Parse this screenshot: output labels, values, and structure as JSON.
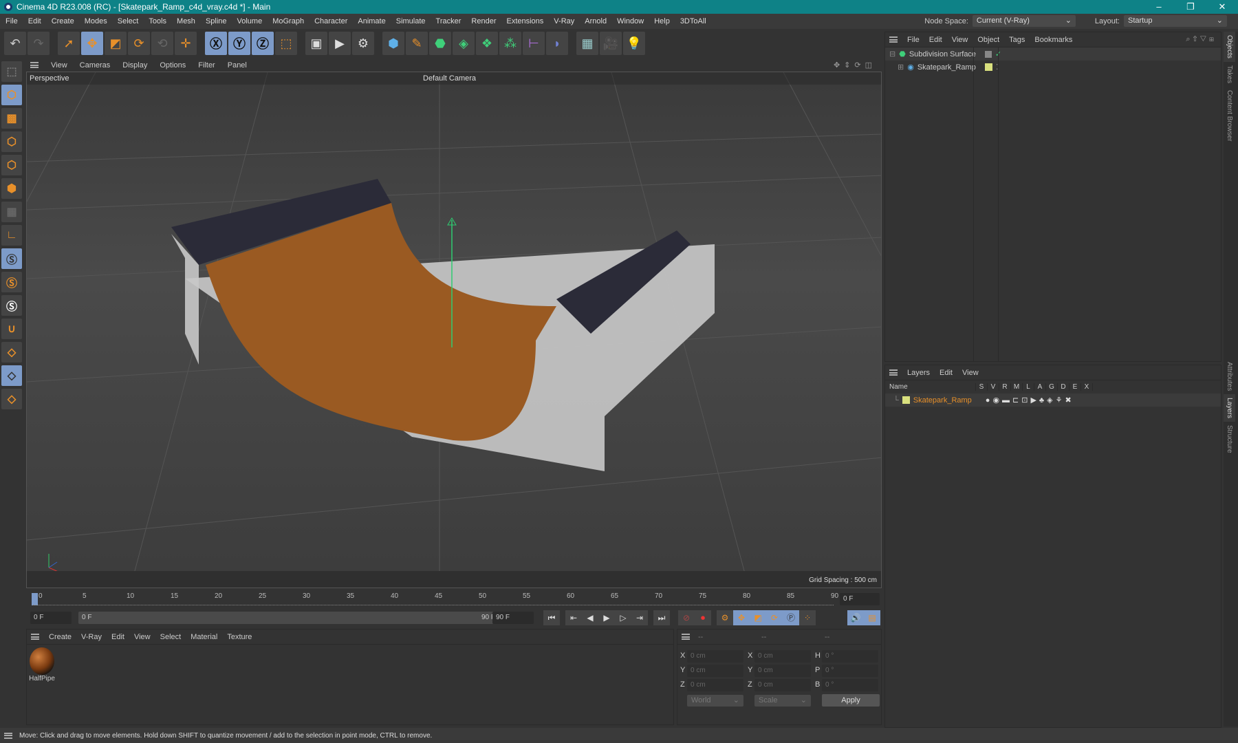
{
  "title": "Cinema 4D R23.008 (RC) - [Skatepark_Ramp_c4d_vray.c4d *] - Main",
  "menu": [
    "File",
    "Edit",
    "Create",
    "Modes",
    "Select",
    "Tools",
    "Mesh",
    "Spline",
    "Volume",
    "MoGraph",
    "Character",
    "Animate",
    "Simulate",
    "Tracker",
    "Render",
    "Extensions",
    "V-Ray",
    "Arnold",
    "Window",
    "Help",
    "3DToAll"
  ],
  "node_space": {
    "label": "Node Space:",
    "value": "Current (V-Ray)"
  },
  "layout": {
    "label": "Layout:",
    "value": "Startup"
  },
  "viewport": {
    "menu": [
      "View",
      "Cameras",
      "Display",
      "Options",
      "Filter",
      "Panel"
    ],
    "name": "Perspective",
    "camera": "Default Camera",
    "grid_spacing": "Grid Spacing : 500 cm"
  },
  "timeline": {
    "ticks": [
      "0",
      "5",
      "10",
      "15",
      "20",
      "25",
      "30",
      "35",
      "40",
      "45",
      "50",
      "55",
      "60",
      "65",
      "70",
      "75",
      "80",
      "85",
      "90"
    ],
    "current": "0 F",
    "start": "0 F",
    "range_start": "0 F",
    "range_end": "90 F",
    "end": "90 F"
  },
  "materials": {
    "menu": [
      "Create",
      "V-Ray",
      "Edit",
      "View",
      "Select",
      "Material",
      "Texture"
    ],
    "items": [
      {
        "name": "HalfPipe"
      }
    ]
  },
  "coords": {
    "headers": [
      "--",
      "--",
      "--"
    ],
    "rows": [
      {
        "a": "X",
        "av": "0 cm",
        "b": "X",
        "bv": "0 cm",
        "c": "H",
        "cv": "0 °"
      },
      {
        "a": "Y",
        "av": "0 cm",
        "b": "Y",
        "bv": "0 cm",
        "c": "P",
        "cv": "0 °"
      },
      {
        "a": "Z",
        "av": "0 cm",
        "b": "Z",
        "bv": "0 cm",
        "c": "B",
        "cv": "0 °"
      }
    ],
    "space": "World",
    "mode": "Scale",
    "apply": "Apply"
  },
  "status": "Move: Click and drag to move elements. Hold down SHIFT to quantize movement / add to the selection in point mode, CTRL to remove.",
  "objects": {
    "menu": [
      "File",
      "Edit",
      "View",
      "Object",
      "Tags",
      "Bookmarks"
    ],
    "items": [
      "Subdivision Surface",
      "Skatepark_Ramp"
    ]
  },
  "layers": {
    "menu": [
      "Layers",
      "Edit",
      "View"
    ],
    "columns": [
      "Name",
      "S",
      "V",
      "R",
      "M",
      "L",
      "A",
      "G",
      "D",
      "E",
      "X"
    ],
    "items": [
      "Skatepark_Ramp"
    ],
    "color": "#e8902a"
  },
  "right_tabs": [
    "Objects",
    "Takes",
    "Content Browser",
    "Attributes",
    "Layers",
    "Structure"
  ]
}
